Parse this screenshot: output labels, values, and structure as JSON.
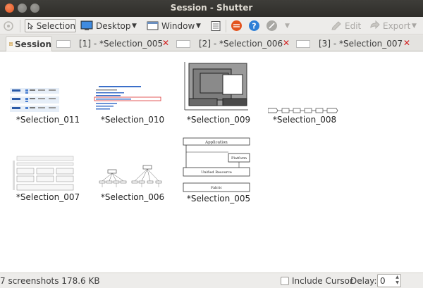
{
  "window": {
    "title": "Session - Shutter"
  },
  "toolbar": {
    "selection": "Selection",
    "desktop": "Desktop",
    "window": "Window",
    "edit": "Edit",
    "export": "Export"
  },
  "tabs": {
    "session": "Session",
    "items": [
      {
        "label": "[1] - *Selection_005"
      },
      {
        "label": "[2] - *Selection_006"
      },
      {
        "label": "[3] - *Selection_007"
      }
    ],
    "close_glyph": "✕"
  },
  "thumbnails": [
    {
      "caption": "*Selection_011"
    },
    {
      "caption": "*Selection_010"
    },
    {
      "caption": "*Selection_009"
    },
    {
      "caption": "*Selection_008"
    },
    {
      "caption": "*Selection_007"
    },
    {
      "caption": "*Selection_006"
    },
    {
      "caption": "*Selection_005"
    }
  ],
  "thumb_text": {
    "application": "Application",
    "platform": "Platform",
    "unified": "Unified Resource",
    "fabric": "Fabric"
  },
  "status": {
    "summary": "7 screenshots  178.6 KB",
    "include_cursor": "Include Cursor",
    "delay_label": "Delay:",
    "delay_value": "0"
  },
  "colors": {
    "close_red": "#d21e1e",
    "accent_orange": "#e3541f",
    "help_blue": "#2e7fd6"
  }
}
